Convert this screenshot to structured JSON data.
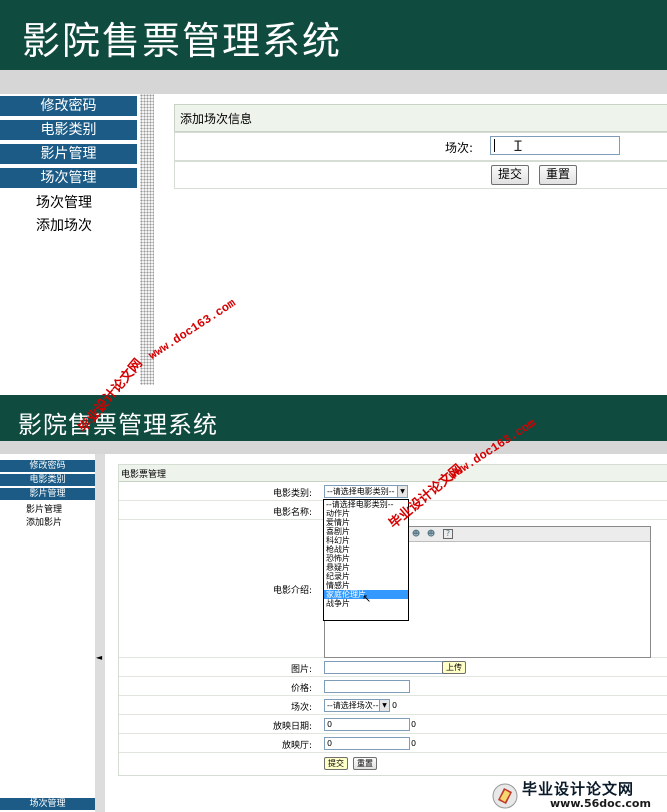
{
  "screen1": {
    "title": "影院售票管理系统",
    "menu": [
      "修改密码",
      "电影类别",
      "影片管理",
      "场次管理"
    ],
    "submenu": [
      "场次管理",
      "添加场次"
    ],
    "caption": "添加场次信息",
    "field_label": "场次:",
    "field_value": "",
    "submit": "提交",
    "reset": "重置"
  },
  "screen2": {
    "title": "影院售票管理系统",
    "menu": [
      "修改密码",
      "电影类别",
      "影片管理"
    ],
    "submenu": [
      "影片管理",
      "添加影片"
    ],
    "bottom_menu": "场次管理",
    "collapse_arrow": "◄",
    "caption": "电影票管理",
    "labels": {
      "category": "电影类别:",
      "name": "电影名称:",
      "intro": "电影介绍:",
      "image": "图片:",
      "price": "价格:",
      "session": "场次:",
      "date": "放映日期:",
      "hall": "放映厅:"
    },
    "category_select": "--请选择电影类别--",
    "category_options": [
      "--请选择电影类别--",
      "动作片",
      "爱情片",
      "喜剧片",
      "科幻片",
      "枪战片",
      "恐怖片",
      "悬疑片",
      "纪录片",
      "情感片",
      "家庭伦理片",
      "战争片"
    ],
    "category_highlight": "家庭伦理片",
    "upload_button": "上传",
    "session_select": "--请选择场次--",
    "session_suffix": "0",
    "date_value": "0",
    "date_suffix": "0",
    "hall_value": "0",
    "hall_suffix": "0",
    "submit": "提交",
    "reset": "重置"
  },
  "watermarks": {
    "url": "www.doc163.com",
    "cn": "毕业设计论文网"
  },
  "logo": {
    "name": "毕业设计论文网",
    "url": "www.56doc.com"
  },
  "colors": {
    "header": "#0f4b3f",
    "menu": "#1b5b86",
    "watermark": "#d40000",
    "highlight": "#3399ff"
  }
}
